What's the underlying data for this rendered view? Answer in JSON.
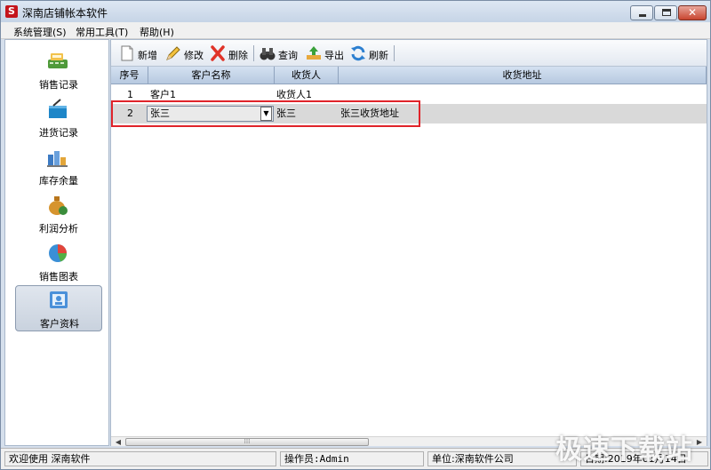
{
  "window": {
    "title": "深南店铺帐本软件",
    "app_icon_letter": "S"
  },
  "menu": [
    {
      "label": "系统管理(S)"
    },
    {
      "label": "常用工具(T)"
    },
    {
      "label": "帮助(H)"
    }
  ],
  "sidebar": {
    "items": [
      {
        "label": "销售记录",
        "icon": "cash-register-icon"
      },
      {
        "label": "进货记录",
        "icon": "basket-icon"
      },
      {
        "label": "库存余量",
        "icon": "stock-boxes-icon"
      },
      {
        "label": "利润分析",
        "icon": "money-bag-icon"
      },
      {
        "label": "销售图表",
        "icon": "pie-chart-icon"
      },
      {
        "label": "客户资料",
        "icon": "contacts-icon",
        "active": true
      }
    ]
  },
  "toolbar": {
    "add": "新增",
    "edit": "修改",
    "delete": "删除",
    "search": "查询",
    "export": "导出",
    "refresh": "刷新"
  },
  "table": {
    "columns": [
      "序号",
      "客户名称",
      "收货人",
      "收货地址"
    ],
    "rows": [
      {
        "no": "1",
        "name": "客户1",
        "receiver": "收货人1",
        "address": ""
      },
      {
        "no": "2",
        "name": "张三",
        "receiver": "张三",
        "address": "张三收货地址"
      }
    ]
  },
  "status": {
    "welcome": "欢迎使用  深南软件",
    "operator": "操作员:Admin",
    "company": "单位:深南软件公司",
    "date": "日期:2019年01月14日"
  },
  "watermark": "极速下载站",
  "colors": {
    "highlight": "#e0242a",
    "header_bg": "#c6d6ea",
    "selected_row": "#d9d9d9"
  }
}
